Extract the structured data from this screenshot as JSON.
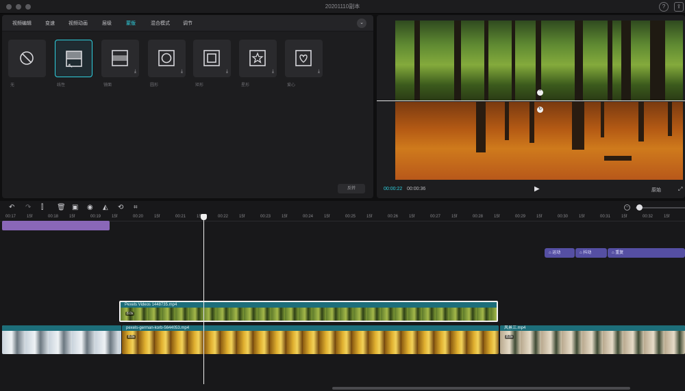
{
  "window": {
    "title": "20201110副本",
    "help_icon": "?",
    "share_icon": "⇪"
  },
  "tabs": [
    {
      "label": "视频编辑",
      "active": false
    },
    {
      "label": "变速",
      "active": false
    },
    {
      "label": "视频动画",
      "active": false
    },
    {
      "label": "层级",
      "active": false
    },
    {
      "label": "蒙版",
      "active": true
    },
    {
      "label": "混合模式",
      "active": false
    },
    {
      "label": "调节",
      "active": false
    }
  ],
  "masks": [
    {
      "label": "无",
      "icon": "none-icon",
      "selected": false,
      "download": false
    },
    {
      "label": "线性",
      "icon": "linear-mask-icon",
      "selected": true,
      "download": false
    },
    {
      "label": "镜面",
      "icon": "mirror-mask-icon",
      "selected": false,
      "download": true
    },
    {
      "label": "圆形",
      "icon": "circle-mask-icon",
      "selected": false,
      "download": true
    },
    {
      "label": "矩形",
      "icon": "rectangle-mask-icon",
      "selected": false,
      "download": true
    },
    {
      "label": "星形",
      "icon": "star-mask-icon",
      "selected": false,
      "download": true
    },
    {
      "label": "爱心",
      "icon": "heart-mask-icon",
      "selected": false,
      "download": true
    }
  ],
  "reverse_label": "反转",
  "player": {
    "current_time": "00:00:22",
    "total_time": "00:00:36",
    "ratio_label": "原始",
    "play_icon": "▶"
  },
  "ruler_labels": [
    "00:17",
    "15f",
    "00:18",
    "15f",
    "00:19",
    "15f",
    "00:20",
    "15f",
    "00:21",
    "15f",
    "00:22",
    "15f",
    "00:23",
    "15f",
    "00:24",
    "15f",
    "00:25",
    "15f",
    "00:26",
    "15f",
    "00:27",
    "15f",
    "00:28",
    "15f",
    "00:29",
    "15f",
    "00:30",
    "15f",
    "00:31",
    "15f",
    "00:32",
    "15f"
  ],
  "effects": [
    {
      "label": "运动"
    },
    {
      "label": "抖动"
    },
    {
      "label": "重复"
    }
  ],
  "clips": [
    {
      "name": "Pexels Videos 1448735.mp4",
      "speed": "8.0x"
    },
    {
      "name": "pexels-german-korb-5644053.mp4",
      "speed": "8.0x"
    },
    {
      "name": "风景三.mp4",
      "speed": "8.0x"
    }
  ],
  "colors": {
    "accent": "#2fd1e0",
    "clip_teal": "#1d6e7a",
    "purple_track": "#8a67b8",
    "effect_chip": "#554fa3"
  }
}
